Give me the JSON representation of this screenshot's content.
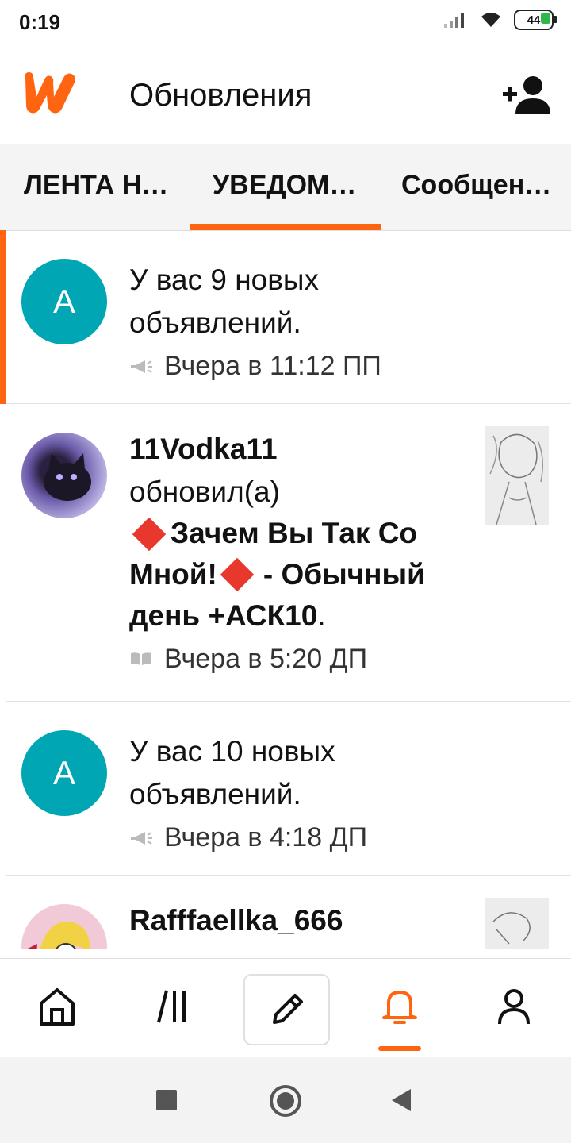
{
  "status_bar": {
    "time": "0:19",
    "battery": "44"
  },
  "app_bar": {
    "title": "Обновления"
  },
  "tabs": [
    {
      "label": "ЛЕНТА Н…",
      "selected": false
    },
    {
      "label": "УВЕДОМ…",
      "selected": true
    },
    {
      "label": "Сообщен…",
      "selected": false
    }
  ],
  "notifications": [
    {
      "avatar_letter": "A",
      "title": "У вас 9 новых объявлений.",
      "time": "Вчера в 11:12 ПП",
      "icon": "megaphone-icon",
      "unread": true
    },
    {
      "user": "11Vodka11",
      "action": "обновил(а)",
      "story_title_line1": "Зачем Вы Так Со",
      "story_title_line2": "Мной!",
      "story_suffix": "- Обычный",
      "story_title_line3": "день +АСК10",
      "period": ".",
      "time": "Вчера в 5:20 ДП",
      "icon": "book-icon"
    },
    {
      "avatar_letter": "A",
      "title": "У вас 10 новых объявлений.",
      "time": "Вчера в 4:18 ДП",
      "icon": "megaphone-icon"
    },
    {
      "user": "Rafffaellka_666"
    }
  ],
  "colors": {
    "accent": "#ff6510",
    "avatar_teal": "#00a6b4"
  }
}
